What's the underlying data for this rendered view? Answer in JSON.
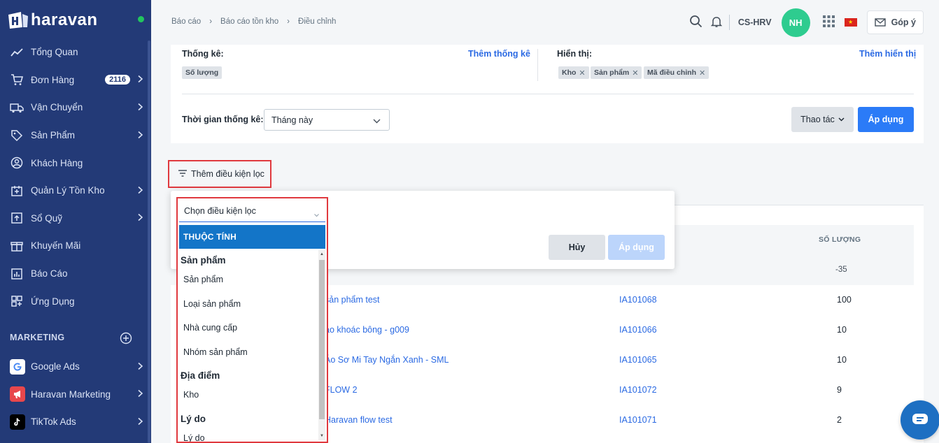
{
  "brand": {
    "name": "haravan"
  },
  "sidebar": {
    "items": [
      {
        "label": "Tổng Quan",
        "icon": "trend-icon",
        "chevron": false
      },
      {
        "label": "Đơn Hàng",
        "icon": "cart-icon",
        "chevron": true,
        "badge": "2116"
      },
      {
        "label": "Vận Chuyển",
        "icon": "truck-icon",
        "chevron": true
      },
      {
        "label": "Sản Phẩm",
        "icon": "tag-icon",
        "chevron": true
      },
      {
        "label": "Khách Hàng",
        "icon": "user-circle-icon",
        "chevron": false
      },
      {
        "label": "Quản Lý Tồn Kho",
        "icon": "inventory-icon",
        "chevron": true
      },
      {
        "label": "Sổ Quỹ",
        "icon": "cashbook-icon",
        "chevron": true
      },
      {
        "label": "Khuyến Mãi",
        "icon": "gift-icon",
        "chevron": false
      },
      {
        "label": "Báo Cáo",
        "icon": "report-icon",
        "chevron": false
      },
      {
        "label": "Ứng Dụng",
        "icon": "apps-icon",
        "chevron": false
      }
    ],
    "marketing_heading": "MARKETING",
    "marketing_items": [
      {
        "label": "Google Ads",
        "icon": "google-icon"
      },
      {
        "label": "Haravan Marketing",
        "icon": "megaphone-icon"
      },
      {
        "label": "TikTok Ads",
        "icon": "tiktok-icon"
      }
    ]
  },
  "header": {
    "breadcrumbs": [
      "Báo cáo",
      "Báo cáo tồn kho",
      "Điều chỉnh"
    ],
    "store": "CS-HRV",
    "avatar_initials": "NH",
    "feedback": "Góp ý"
  },
  "config": {
    "stats_label": "Thống kê:",
    "stats_link": "Thêm thống kê",
    "stats_chips": [
      "Số lượng"
    ],
    "display_label": "Hiển thị:",
    "display_link": "Thêm hiển thị",
    "display_chips": [
      "Kho",
      "Sản phẩm",
      "Mã điều chỉnh"
    ],
    "time_label": "Thời gian thống kê:",
    "time_value": "Tháng này",
    "actions_label": "Thao tác",
    "apply_label": "Áp dụng"
  },
  "filter": {
    "trigger_label": "Thêm điều kiện lọc",
    "select_placeholder": "Chọn điều kiện lọc",
    "cancel_label": "Hủy",
    "apply_label": "Áp dụng",
    "list_heading": "THUỘC TÍNH",
    "groups": [
      {
        "name": "Sản phẩm",
        "options": [
          "Sản phẩm",
          "Loại sản phẩm",
          "Nhà cung cấp",
          "Nhóm sản phẩm"
        ]
      },
      {
        "name": "Địa điểm",
        "options": [
          "Kho"
        ]
      },
      {
        "name": "Lý do",
        "options": [
          "Lý do"
        ]
      }
    ]
  },
  "table": {
    "qty_header": "SỐ LƯỢNG",
    "total_qty": "-35",
    "rows": [
      {
        "name": "sản phẩm test",
        "code": "IA101068",
        "qty": "100"
      },
      {
        "name": "áo khoác bông - g009",
        "code": "IA101066",
        "qty": "10"
      },
      {
        "name": "Áo Sơ Mi Tay Ngắn Xanh - SML",
        "code": "IA101065",
        "qty": "10"
      },
      {
        "name": "FLOW 2",
        "code": "IA101072",
        "qty": "9"
      },
      {
        "name": "Haravan flow test",
        "code": "IA101071",
        "qty": "2"
      }
    ]
  },
  "colors": {
    "sidebar_bg": "#233a77",
    "link": "#2b6ae3",
    "primary": "#2b7bf7",
    "highlight_frame": "#e0393e",
    "list_heading_bg": "#1375c8",
    "avatar": "#2ecc8f"
  }
}
